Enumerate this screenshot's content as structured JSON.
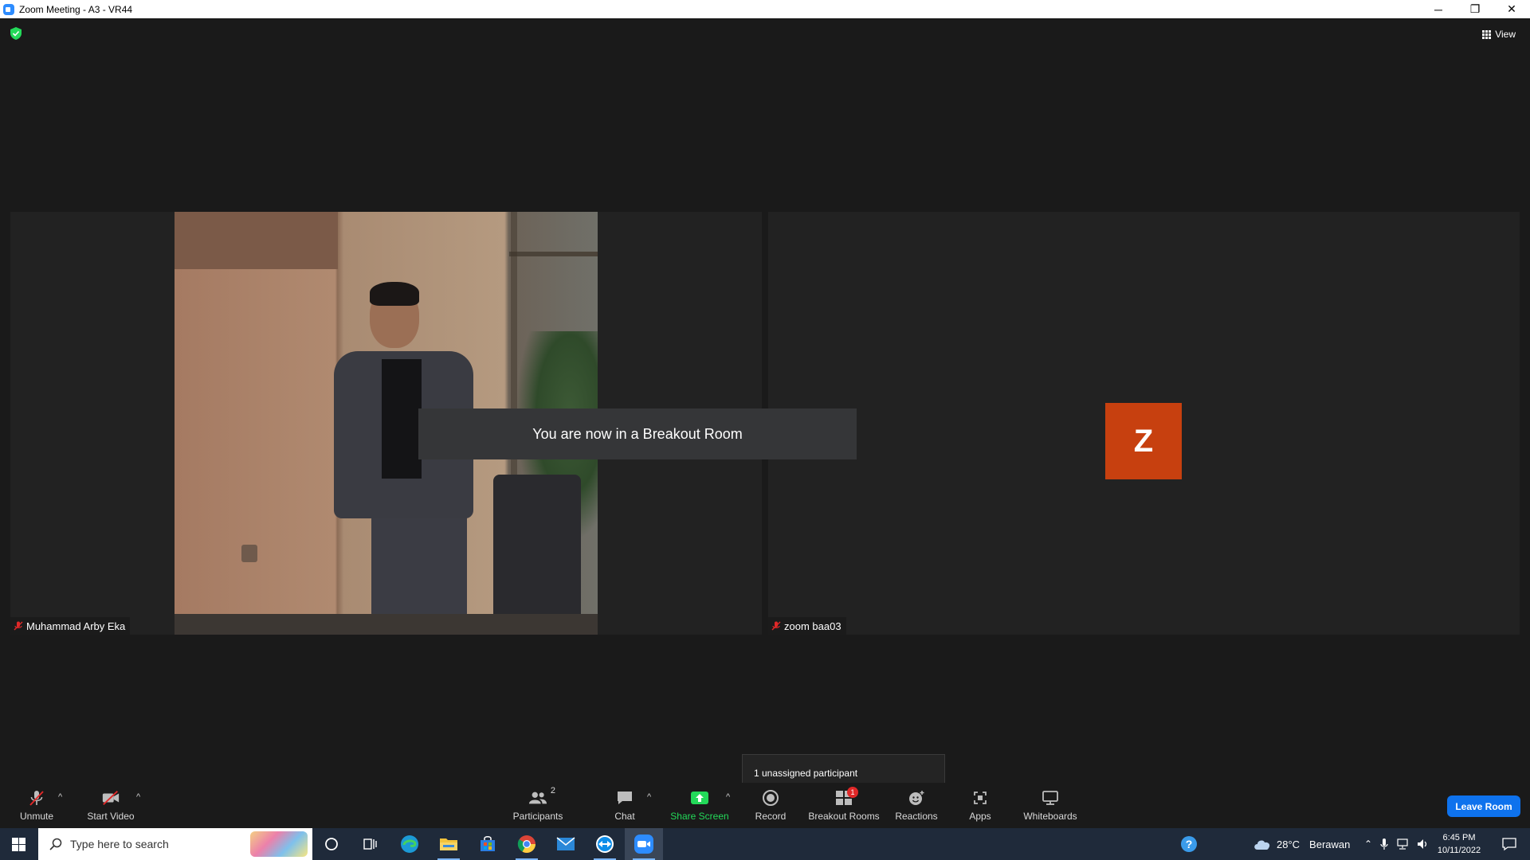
{
  "window": {
    "title": "Zoom Meeting - A3 - VR44",
    "minimize_glyph": "─",
    "restore_glyph": "❐",
    "close_glyph": "✕"
  },
  "meeting": {
    "view_label": "View",
    "notice": "You are now in a Breakout Room",
    "participants": [
      {
        "name": "Muhammad Arby Eka",
        "muted": true,
        "video_on": true
      },
      {
        "name": "zoom baa03",
        "muted": true,
        "video_on": false,
        "avatar_letter": "Z",
        "avatar_color": "#c7400f"
      }
    ],
    "tooltip": "1 unassigned participant"
  },
  "toolbar": {
    "unmute_label": "Unmute",
    "start_video_label": "Start Video",
    "participants_label": "Participants",
    "participants_count": "2",
    "chat_label": "Chat",
    "share_screen_label": "Share Screen",
    "record_label": "Record",
    "breakout_rooms_label": "Breakout Rooms",
    "breakout_badge": "1",
    "reactions_label": "Reactions",
    "apps_label": "Apps",
    "whiteboards_label": "Whiteboards",
    "leave_label": "Leave Room",
    "caret": "^"
  },
  "taskbar": {
    "search_placeholder": "Type here to search",
    "weather_temp": "28°C",
    "weather_desc": "Berawan",
    "time": "6:45 PM",
    "date": "10/11/2022"
  },
  "colors": {
    "share_green": "#23d959",
    "leave_blue": "#0e72ed",
    "muted_red": "#e02828"
  }
}
